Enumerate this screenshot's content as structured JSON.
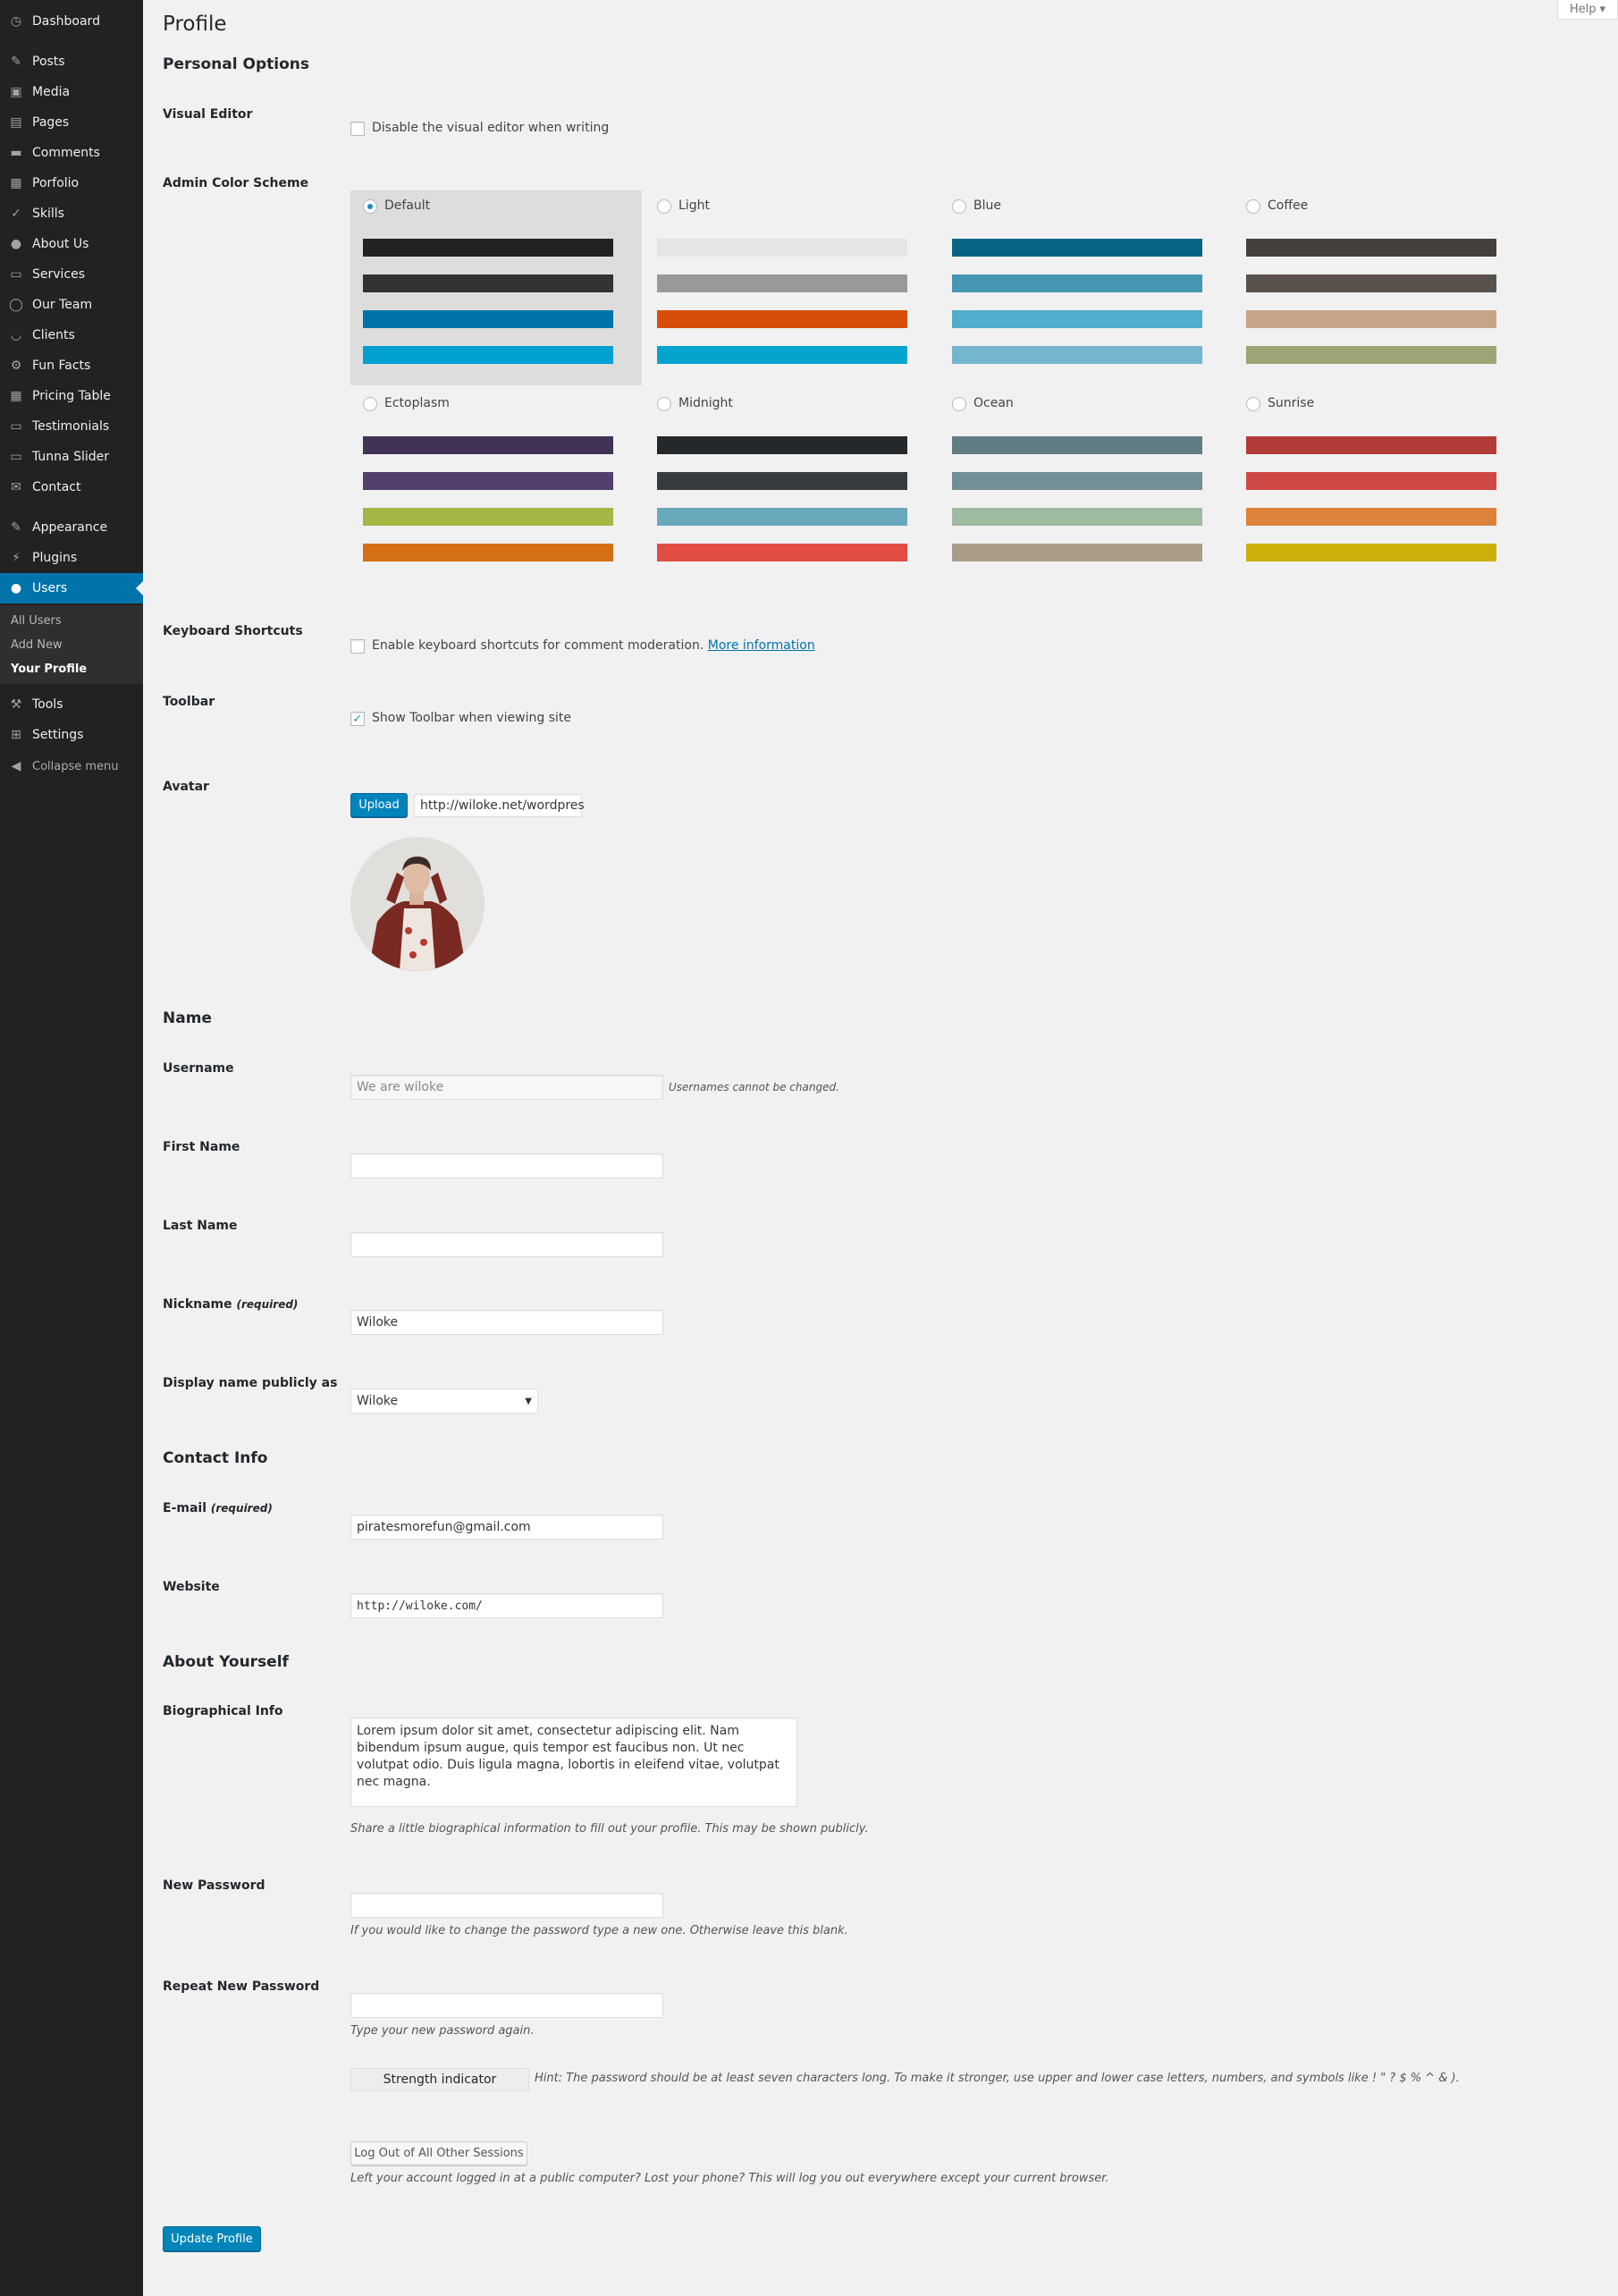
{
  "sidebar": {
    "items": [
      {
        "label": "Dashboard",
        "icon": "dashboard-icon",
        "glyph": "◷"
      },
      {
        "label": "Posts",
        "icon": "pushpin-icon",
        "glyph": "✎"
      },
      {
        "label": "Media",
        "icon": "media-icon",
        "glyph": "▣"
      },
      {
        "label": "Pages",
        "icon": "pages-icon",
        "glyph": "▤"
      },
      {
        "label": "Comments",
        "icon": "comments-icon",
        "glyph": "▬"
      },
      {
        "label": "Porfolio",
        "icon": "portfolio-icon",
        "glyph": "▦"
      },
      {
        "label": "Skills",
        "icon": "check-icon",
        "glyph": "✓"
      },
      {
        "label": "About Us",
        "icon": "info-icon",
        "glyph": "●"
      },
      {
        "label": "Services",
        "icon": "services-icon",
        "glyph": "▭"
      },
      {
        "label": "Our Team",
        "icon": "team-icon",
        "glyph": "◯"
      },
      {
        "label": "Clients",
        "icon": "smiley-icon",
        "glyph": "◡"
      },
      {
        "label": "Fun Facts",
        "icon": "funfacts-icon",
        "glyph": "⚙"
      },
      {
        "label": "Pricing Table",
        "icon": "pricing-icon",
        "glyph": "▦"
      },
      {
        "label": "Testimonials",
        "icon": "testimonials-icon",
        "glyph": "▭"
      },
      {
        "label": "Tunna Slider",
        "icon": "slider-icon",
        "glyph": "▭"
      },
      {
        "label": "Contact",
        "icon": "mail-icon",
        "glyph": "✉"
      },
      {
        "label": "Appearance",
        "icon": "brush-icon",
        "glyph": "✎"
      },
      {
        "label": "Plugins",
        "icon": "plugin-icon",
        "glyph": "⚡"
      },
      {
        "label": "Users",
        "icon": "user-icon",
        "glyph": "●"
      },
      {
        "label": "Tools",
        "icon": "wrench-icon",
        "glyph": "⚒"
      },
      {
        "label": "Settings",
        "icon": "settings-icon",
        "glyph": "⊞"
      }
    ],
    "submenu": [
      "All Users",
      "Add New",
      "Your Profile"
    ],
    "collapse_label": "Collapse menu"
  },
  "help_label": "Help",
  "page_title": "Profile",
  "personal_options": {
    "title": "Personal Options",
    "visual_editor_label": "Visual Editor",
    "visual_editor_checkbox": "Disable the visual editor when writing",
    "color_scheme_label": "Admin Color Scheme",
    "schemes": [
      {
        "name": "Default",
        "selected": true,
        "colors": [
          "#222222",
          "#333333",
          "#0073aa",
          "#00a0d2"
        ]
      },
      {
        "name": "Light",
        "selected": false,
        "colors": [
          "#e5e5e5",
          "#999999",
          "#d64e07",
          "#04a4cc"
        ]
      },
      {
        "name": "Blue",
        "selected": false,
        "colors": [
          "#096484",
          "#4796b3",
          "#52accc",
          "#74b6ce"
        ]
      },
      {
        "name": "Coffee",
        "selected": false,
        "colors": [
          "#46403c",
          "#59524c",
          "#c7a589",
          "#9ea476"
        ]
      },
      {
        "name": "Ectoplasm",
        "selected": false,
        "colors": [
          "#413256",
          "#523f6d",
          "#a3b745",
          "#d46f15"
        ]
      },
      {
        "name": "Midnight",
        "selected": false,
        "colors": [
          "#25282b",
          "#363b3f",
          "#69a8bb",
          "#e14d43"
        ]
      },
      {
        "name": "Ocean",
        "selected": false,
        "colors": [
          "#627c83",
          "#738e96",
          "#9ebaa0",
          "#aa9d88"
        ]
      },
      {
        "name": "Sunrise",
        "selected": false,
        "colors": [
          "#b43c38",
          "#cf4944",
          "#dd823b",
          "#ccaf0b"
        ]
      }
    ],
    "keyboard_label": "Keyboard Shortcuts",
    "keyboard_checkbox": "Enable keyboard shortcuts for comment moderation.",
    "keyboard_link": "More information",
    "toolbar_label": "Toolbar",
    "toolbar_checkbox": "Show Toolbar when viewing site",
    "toolbar_checked": true,
    "avatar_label": "Avatar",
    "upload_button": "Upload",
    "avatar_url": "http://wiloke.net/wordpres"
  },
  "name_section": {
    "title": "Name",
    "username_label": "Username",
    "username_value": "We are wiloke",
    "username_hint": "Usernames cannot be changed.",
    "first_name_label": "First Name",
    "first_name_value": "",
    "last_name_label": "Last Name",
    "last_name_value": "",
    "nickname_label": "Nickname",
    "required": "(required)",
    "nickname_value": "Wiloke",
    "display_name_label": "Display name publicly as",
    "display_name_value": "Wiloke"
  },
  "contact": {
    "title": "Contact Info",
    "email_label": "E-mail",
    "email_value": "piratesmorefun@gmail.com",
    "website_label": "Website",
    "website_value": "http://wiloke.com/"
  },
  "about": {
    "title": "About Yourself",
    "bio_label": "Biographical Info",
    "bio_value": "Lorem ipsum dolor sit amet, consectetur adipiscing elit. Nam bibendum ipsum augue, quis tempor est faucibus non. Ut nec volutpat odio. Duis ligula magna, lobortis in eleifend vitae, volutpat nec magna.",
    "bio_hint": "Share a little biographical information to fill out your profile. This may be shown publicly.",
    "new_password_label": "New Password",
    "new_password_hint": "If you would like to change the password type a new one. Otherwise leave this blank.",
    "repeat_password_label": "Repeat New Password",
    "repeat_password_hint": "Type your new password again.",
    "strength_label": "Strength indicator",
    "strength_hint": "Hint: The password should be at least seven characters long. To make it stronger, use upper and lower case letters, numbers, and symbols like ! \" ? $ % ^ & ).",
    "logout_button": "Log Out of All Other Sessions",
    "logout_hint": "Left your account logged in at a public computer? Lost your phone? This will log you out everywhere except your current browser.",
    "update_button": "Update Profile"
  }
}
